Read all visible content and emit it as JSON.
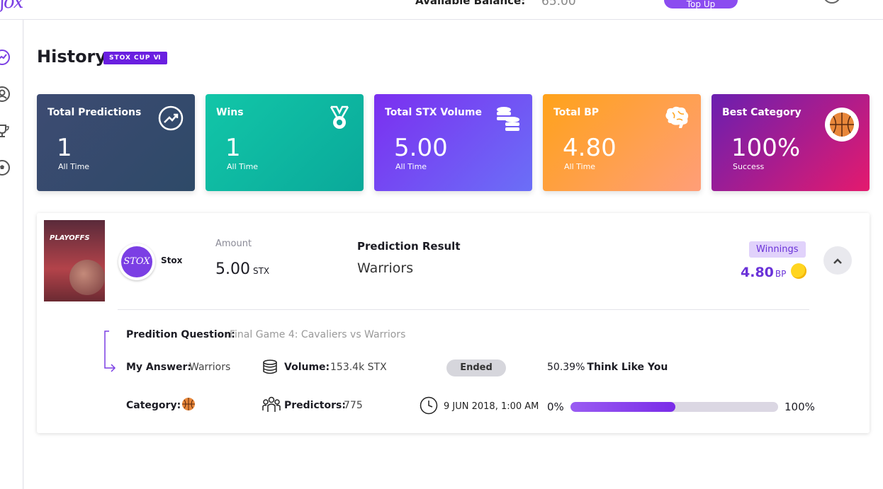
{
  "header": {
    "available_balance_label": "Available Balance:",
    "available_balance_value": "65.00",
    "topup_label": "Top Up"
  },
  "page": {
    "title": "History",
    "badge": "STOX CUP Ⅵ"
  },
  "stats": [
    {
      "title": "Total Predictions",
      "value": "1",
      "sub": "All Time",
      "icon": "trend-up-icon"
    },
    {
      "title": "Wins",
      "value": "1",
      "sub": "All Time",
      "icon": "medal-icon"
    },
    {
      "title": "Total STX Volume",
      "value": "5.00",
      "sub": "All Time",
      "icon": "coins-icon"
    },
    {
      "title": "Total BP",
      "value": "4.80",
      "sub": "All Time",
      "icon": "brain-icon"
    },
    {
      "title": "Best Category",
      "value": "100%",
      "sub": "Success",
      "icon": "basketball-icon"
    }
  ],
  "prediction": {
    "thumb_text": "PLAYOFFS",
    "avatar_text": "STOX",
    "name": "Stox",
    "amount_label": "Amount",
    "amount_value": "5.00",
    "amount_unit": "STX",
    "result_label": "Prediction Result",
    "result_value": "Warriors",
    "winnings_label": "Winnings",
    "winnings_value": "4.80",
    "winnings_unit": "BP",
    "question_label": "Predition Question:",
    "question_value": "Final Game 4: Cavaliers vs Warriors",
    "answer_label": "My Answer:",
    "answer_value": "Warriors",
    "volume_label": "Volume:",
    "volume_value": "153.4k STX",
    "status": "Ended",
    "think_percent": "50.39%",
    "think_label": "Think Like You",
    "category_label": "Category:",
    "predictors_label": "Predictors:",
    "predictors_value": "775",
    "date": "9 JUN 2018, 1:00 AM",
    "progress_min": "0%",
    "progress_max": "100%",
    "progress_fraction": 0.5039
  },
  "colors": {
    "accent": "#7b3fe4",
    "winnings": "#6a32d8"
  }
}
